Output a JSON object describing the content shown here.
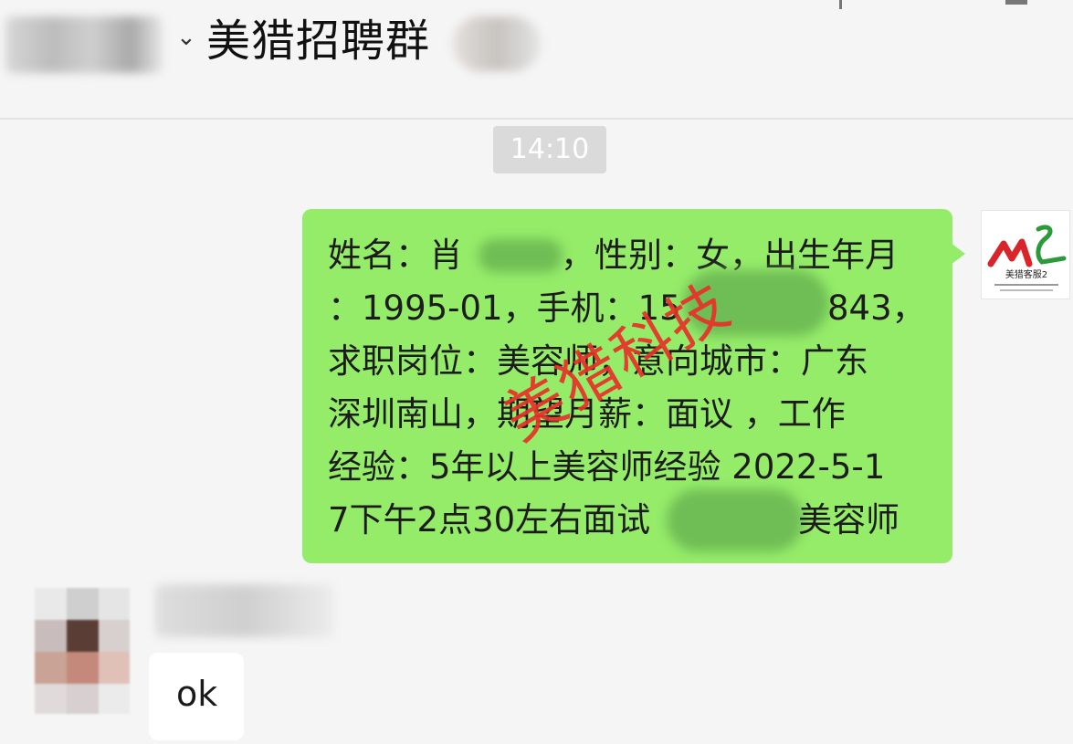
{
  "header": {
    "chevron": "⌄",
    "group_title": "美猎招聘群"
  },
  "timestamp": "14:10",
  "sent_message": {
    "lines": [
      "姓名：肖",
      "，性别：女，出生年月",
      "：1995-01，手机：15",
      "843，",
      "求职岗位：美容师，意向城市：广东",
      "深圳南山，期望月薪：面议 ，工作",
      "经验：5年以上美容师经验 2022-5-1",
      "7下午2点30左右面试",
      "美容师"
    ],
    "watermark": "美猎科技"
  },
  "contact_avatar": {
    "logo_text": "ML",
    "caption": "美猎客服2"
  },
  "received_message": {
    "text": "ok"
  },
  "colors": {
    "bubble_sent": "#95ec69",
    "bubble_received": "#ffffff",
    "background": "#f5f5f5",
    "watermark": "#e8302a"
  }
}
